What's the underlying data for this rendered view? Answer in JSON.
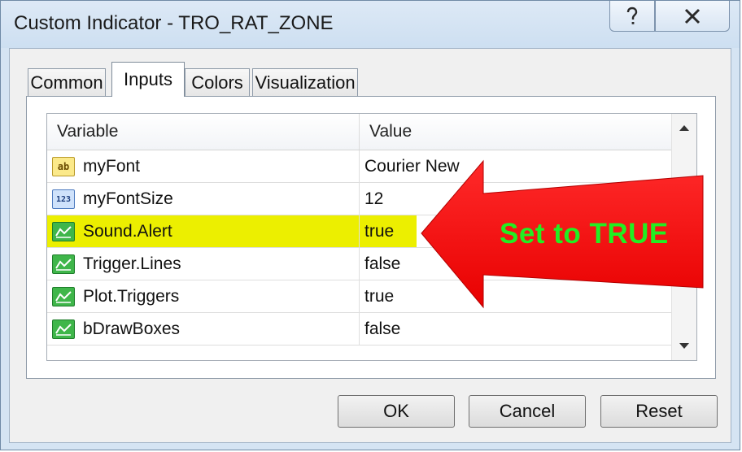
{
  "window": {
    "title": "Custom Indicator - TRO_RAT_ZONE",
    "help_icon": "question-mark-icon",
    "close_icon": "close-x-icon"
  },
  "tabs": [
    {
      "label": "Common",
      "active": false
    },
    {
      "label": "Inputs",
      "active": true
    },
    {
      "label": "Colors",
      "active": false
    },
    {
      "label": "Visualization",
      "active": false
    }
  ],
  "grid": {
    "columns": {
      "variable": "Variable",
      "value": "Value"
    },
    "rows": [
      {
        "icon": "string-ab-icon",
        "icon_text": "ab",
        "name": "myFont",
        "value": "Courier New"
      },
      {
        "icon": "number-123-icon",
        "icon_text": "123",
        "name": "myFontSize",
        "value": "12"
      },
      {
        "icon": "boolean-icon",
        "name": "Sound.Alert",
        "value": "true",
        "highlighted": true
      },
      {
        "icon": "boolean-icon",
        "name": "Trigger.Lines",
        "value": "false"
      },
      {
        "icon": "boolean-icon",
        "name": "Plot.Triggers",
        "value": "true"
      },
      {
        "icon": "boolean-icon",
        "name": "bDrawBoxes",
        "value": "false"
      }
    ]
  },
  "buttons": {
    "ok": "OK",
    "cancel": "Cancel",
    "reset": "Reset"
  },
  "annotation": {
    "text": "Set to TRUE",
    "arrow_color": "#ff0000",
    "text_color": "#22ee22",
    "highlight_color": "#ecef00"
  }
}
